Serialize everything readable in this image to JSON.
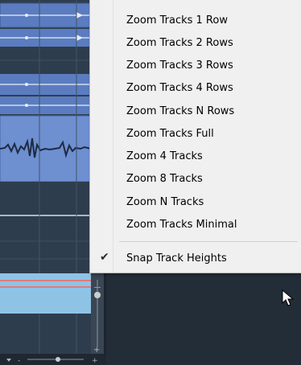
{
  "context_menu": {
    "items": [
      {
        "label": "Zoom Tracks 1 Row",
        "checked": false
      },
      {
        "label": "Zoom Tracks 2 Rows",
        "checked": false
      },
      {
        "label": "Zoom Tracks 3 Rows",
        "checked": false
      },
      {
        "label": "Zoom Tracks 4 Rows",
        "checked": false
      },
      {
        "label": "Zoom Tracks N Rows",
        "checked": false
      },
      {
        "label": "Zoom Tracks Full",
        "checked": false
      },
      {
        "label": "Zoom 4 Tracks",
        "checked": false
      },
      {
        "label": "Zoom 8 Tracks",
        "checked": false
      },
      {
        "label": "Zoom N Tracks",
        "checked": false
      },
      {
        "label": "Zoom Tracks Minimal",
        "checked": false
      }
    ],
    "snap_item": {
      "label": "Snap Track Heights",
      "checked": true,
      "check_glyph": "✔"
    }
  },
  "colors": {
    "track_blue": "#6688c8",
    "track_dark": "#2e3d4e",
    "selected_track": "#8fc3e6",
    "menu_bg": "#f0f0f0"
  }
}
